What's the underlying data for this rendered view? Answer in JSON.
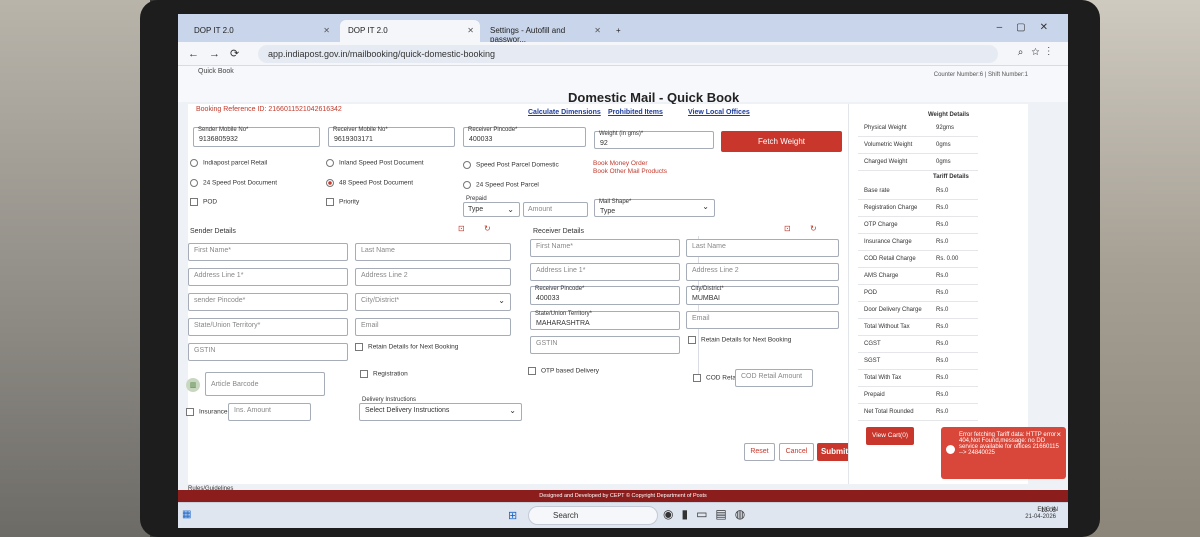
{
  "browser": {
    "tabs": [
      {
        "label": "DOP IT 2.0"
      },
      {
        "label": "DOP IT 2.0"
      },
      {
        "label": "Settings - Autofill and passwor..."
      }
    ],
    "url": "app.indiapost.gov.in/mailbooking/quick-domestic-booking"
  },
  "header": {
    "breadcrumb": "Quick Book",
    "title": "Domestic Mail - Quick Book",
    "counter": "Counter Number:6 | Shift Number:1"
  },
  "booking": {
    "reference": "Booking Reference ID: 2166011521042616342",
    "links": [
      "Calculate Dimensions",
      "Prohibited Items",
      "View Local Offices"
    ],
    "sender_mobile": {
      "label": "Sender Mobile No*",
      "value": "9136805932"
    },
    "receiver_mobile": {
      "label": "Receiver Mobile No*",
      "value": "9619303171"
    },
    "receiver_pincode": {
      "label": "Receiver Pincode*",
      "value": "400033"
    },
    "weight": {
      "label": "Weight (in gms)*",
      "value": "92"
    },
    "fetch_weight": "Fetch Weight",
    "services": [
      "Indiapost parcel Retail",
      "Inland Speed Post Document",
      "Speed Post Parcel Domestic",
      "24 Speed Post Document",
      "48 Speed Post Document",
      "24 Speed Post Parcel",
      "POD",
      "Priority"
    ],
    "book_money_order": "Book Money Order",
    "book_other": "Book Other Mail Products",
    "prepaid": {
      "label": "Prepaid",
      "type": "Type",
      "amount": "Amount"
    },
    "mail_shape": {
      "label": "Mail Shape*",
      "value": "Type"
    }
  },
  "sender": {
    "heading": "Sender Details",
    "first_name": "First Name*",
    "last_name": "Last Name",
    "addr1": "Address Line 1*",
    "addr2": "Address Line 2",
    "pincode": "sender Pincode*",
    "city": "City/District*",
    "state": "State/Union Territory*",
    "email": "Email",
    "gstin": "GSTIN",
    "retain": "Retain Details for Next Booking"
  },
  "receiver": {
    "heading": "Receiver Details",
    "first_name": "First Name*",
    "last_name": "Last Name",
    "addr1": "Address Line 1*",
    "addr2": "Address Line 2",
    "pincode_label": "Receiver Pincode*",
    "pincode": "400033",
    "city_label": "City/District*",
    "city": "MUMBAI",
    "state_label": "State/Union Territory*",
    "state": "MAHARASHTRA",
    "email": "Email",
    "gstin": "GSTIN",
    "retain": "Retain Details for Next Booking"
  },
  "extras": {
    "article_barcode": "Article Barcode",
    "registration": "Registration",
    "otp_delivery": "OTP based Delivery",
    "cod_retail": "COD Retail",
    "cod_amount": "COD Retail Amount",
    "insurance": "Insurance",
    "ins_amount": "Ins. Amount",
    "delivery_label": "Delivery Instructions",
    "delivery_value": "Select Delivery Instructions"
  },
  "actions": {
    "reset": "Reset",
    "cancel": "Cancel",
    "submit": "Submit",
    "view_cart": "View Cart(0)"
  },
  "weight_details": {
    "heading": "Weight Details",
    "rows": [
      {
        "k": "Physical Weight",
        "v": "92gms"
      },
      {
        "k": "Volumetric Weight",
        "v": "0gms"
      },
      {
        "k": "Charged Weight",
        "v": "0gms"
      }
    ]
  },
  "tariff_details": {
    "heading": "Tariff Details",
    "rows": [
      {
        "k": "Base rate",
        "v": "Rs.0"
      },
      {
        "k": "Registration Charge",
        "v": "Rs.0"
      },
      {
        "k": "OTP Charge",
        "v": "Rs.0"
      },
      {
        "k": "Insurance Charge",
        "v": "Rs.0"
      },
      {
        "k": "COD Retail Charge",
        "v": "Rs. 0.00"
      },
      {
        "k": "AMS Charge",
        "v": "Rs.0"
      },
      {
        "k": "POD",
        "v": "Rs.0"
      },
      {
        "k": "Door Delivery Charge",
        "v": "Rs.0"
      },
      {
        "k": "Total Without Tax",
        "v": "Rs.0"
      },
      {
        "k": "CGST",
        "v": "Rs.0"
      },
      {
        "k": "SGST",
        "v": "Rs.0"
      },
      {
        "k": "Total With Tax",
        "v": "Rs.0"
      },
      {
        "k": "Prepaid",
        "v": "Rs.0"
      },
      {
        "k": "Net Total Rounded",
        "v": "Rs.0"
      }
    ]
  },
  "toast": "Error fetching Tariff data: HTTP error 404,Not Found,message: no DD service available for offices 21660115 --> 24840025",
  "footer": "Designed and Developed by CEPT © Copyright Department of Posts",
  "rules": "Rules/Guidelines",
  "taskbar": {
    "search": "Search",
    "lang": "ENG IN",
    "time": "13:05",
    "date": "21-04-2026"
  }
}
